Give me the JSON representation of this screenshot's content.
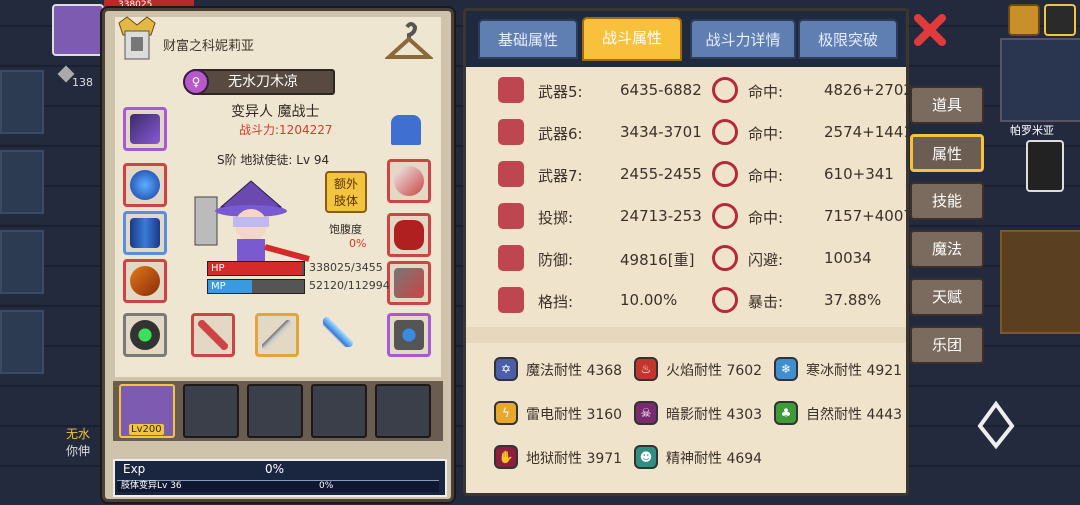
{
  "hud": {
    "level_badge": "138",
    "hp_top": "338025",
    "map_label": "帕罗米亚",
    "chat_name": "无水",
    "chat_text": "你伸"
  },
  "character": {
    "title": "财富之科妮莉亚",
    "gender_icon": "♀",
    "name": "无水刀木凉",
    "class": "变异人 魔战士",
    "power": "战斗力:1204227",
    "rank": "S阶 地狱使徒: Lv 94",
    "extra_limb_btn": [
      "额外",
      "肢体"
    ],
    "satiety_label": "饱腹度",
    "satiety_value": "0%",
    "hp_label": "HP",
    "hp_value": "338025/3455",
    "hp_fill": 0.98,
    "mp_label": "MP",
    "mp_value": "52120/112994",
    "mp_fill": 0.46,
    "pet_level": "Lv200",
    "exp_label": "Exp",
    "exp_value": "0%",
    "mutation_label": "肢体变异Lv 36",
    "mutation_value": "0%"
  },
  "tabs": [
    {
      "label": "基础属性",
      "active": false
    },
    {
      "label": "战斗属性",
      "active": true
    },
    {
      "label": "战斗力详情",
      "active": false
    },
    {
      "label": "极限突破",
      "active": false
    }
  ],
  "combat_stats": [
    {
      "icon": "sword-icon",
      "label": "武器5:",
      "value": "6435-6882",
      "sub_icon": "target-icon",
      "sub_label": "命中:",
      "sub_value": "4826+2702"
    },
    {
      "icon": "sword-icon",
      "label": "武器6:",
      "value": "3434-3701",
      "sub_icon": "target-icon",
      "sub_label": "命中:",
      "sub_value": "2574+1441"
    },
    {
      "icon": "sword-icon",
      "label": "武器7:",
      "value": "2455-2455",
      "sub_icon": "target-icon",
      "sub_label": "命中:",
      "sub_value": "610+341"
    },
    {
      "icon": "bow-icon",
      "label": "投掷:",
      "value": "24713-253",
      "sub_icon": "target-icon",
      "sub_label": "命中:",
      "sub_value": "7157+4007"
    },
    {
      "icon": "shield-icon",
      "label": "防御:",
      "value": "49816[重]",
      "sub_icon": "dodge-icon",
      "sub_label": "闪避:",
      "sub_value": "10034"
    },
    {
      "icon": "parry-icon",
      "label": "格挡:",
      "value": "10.00%",
      "sub_icon": "crit-icon",
      "sub_label": "暴击:",
      "sub_value": "37.88%"
    }
  ],
  "resistances": [
    {
      "label": "魔法耐性 4368",
      "color": "#4a5fa8",
      "glyph": "✡"
    },
    {
      "label": "火焰耐性 7602",
      "color": "#c2362e",
      "glyph": "♨"
    },
    {
      "label": "寒冰耐性 4921",
      "color": "#3f8fd0",
      "glyph": "❄"
    },
    {
      "label": "雷电耐性 3160",
      "color": "#e8a92a",
      "glyph": "ϟ"
    },
    {
      "label": "暗影耐性 4303",
      "color": "#7a2a6e",
      "glyph": "☠"
    },
    {
      "label": "自然耐性 4443",
      "color": "#3f9a3a",
      "glyph": "♣"
    },
    {
      "label": "地狱耐性 3971",
      "color": "#8b1f3d",
      "glyph": "✋"
    },
    {
      "label": "精神耐性 4694",
      "color": "#2f8f80",
      "glyph": "☻"
    }
  ],
  "side_menu": [
    {
      "label": "道具",
      "active": false
    },
    {
      "label": "属性",
      "active": true
    },
    {
      "label": "技能",
      "active": false
    },
    {
      "label": "魔法",
      "active": false
    },
    {
      "label": "天赋",
      "active": false
    },
    {
      "label": "乐团",
      "active": false
    }
  ],
  "colors": {
    "power_red": "#d43a2a",
    "tab_blue": "#5f7fb3",
    "tab_active": "#f7c13c",
    "close_red": "#e03a3a"
  }
}
